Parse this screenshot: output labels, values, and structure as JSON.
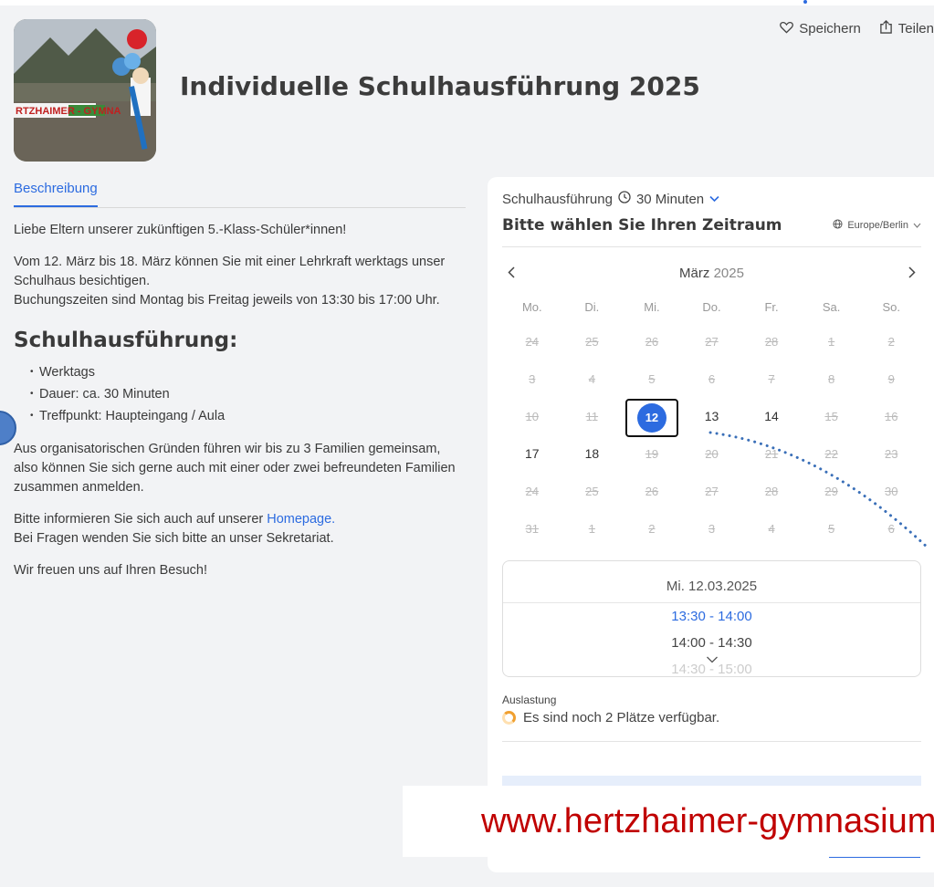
{
  "header": {
    "title": "Individuelle Schulhausführung 2025",
    "image_text": "RTZHAIMER - GYMNA",
    "save_label": "Speichern",
    "share_label": "Teilen"
  },
  "description": {
    "tab_label": "Beschreibung",
    "greeting": "Liebe Eltern unserer zukünftigen 5.-Klass-Schüler*innen!",
    "para1_line1": "Vom 12. März bis 18. März können Sie mit einer Lehrkraft werktags unser Schulhaus besichtigen.",
    "para1_line2": "Buchungszeiten sind Montag bis Freitag jeweils von 13:30 bis 17:00 Uhr.",
    "section_heading": "Schulhausführung:",
    "bullets": [
      "Werktags",
      "Dauer: ca. 30 Minuten",
      "Treffpunkt: Haupteingang / Aula"
    ],
    "para2": "Aus organisatorischen Gründen führen wir bis zu 3 Familien gemeinsam, also können Sie sich gerne auch mit einer oder zwei befreundeten Familien zusammen anmelden.",
    "para3_prefix": "Bitte informieren Sie sich auch auf unserer ",
    "para3_link": "Homepage.",
    "para3_line2": "Bei Fragen wenden Sie sich bitte an unser Sekretariat.",
    "closing": "Wir freuen uns auf Ihren Besuch!"
  },
  "booking": {
    "service_name": "Schulhausführung",
    "duration": "30 Minuten",
    "choose_title": "Bitte wählen Sie Ihren Zeitraum",
    "timezone": "Europe/Berlin",
    "month": "März",
    "year": "2025",
    "weekdays": [
      "Mo.",
      "Di.",
      "Mi.",
      "Do.",
      "Fr.",
      "Sa.",
      "So."
    ],
    "weeks": [
      [
        {
          "d": "24",
          "s": "off"
        },
        {
          "d": "25",
          "s": "off"
        },
        {
          "d": "26",
          "s": "off"
        },
        {
          "d": "27",
          "s": "off"
        },
        {
          "d": "28",
          "s": "off"
        },
        {
          "d": "1",
          "s": "off"
        },
        {
          "d": "2",
          "s": "off"
        }
      ],
      [
        {
          "d": "3",
          "s": "off"
        },
        {
          "d": "4",
          "s": "off"
        },
        {
          "d": "5",
          "s": "off"
        },
        {
          "d": "6",
          "s": "off"
        },
        {
          "d": "7",
          "s": "off"
        },
        {
          "d": "8",
          "s": "off"
        },
        {
          "d": "9",
          "s": "off"
        }
      ],
      [
        {
          "d": "10",
          "s": "off"
        },
        {
          "d": "11",
          "s": "off"
        },
        {
          "d": "12",
          "s": "sel"
        },
        {
          "d": "13",
          "s": "on"
        },
        {
          "d": "14",
          "s": "on"
        },
        {
          "d": "15",
          "s": "off"
        },
        {
          "d": "16",
          "s": "off"
        }
      ],
      [
        {
          "d": "17",
          "s": "on"
        },
        {
          "d": "18",
          "s": "on"
        },
        {
          "d": "19",
          "s": "off"
        },
        {
          "d": "20",
          "s": "off"
        },
        {
          "d": "21",
          "s": "off"
        },
        {
          "d": "22",
          "s": "off"
        },
        {
          "d": "23",
          "s": "off"
        }
      ],
      [
        {
          "d": "24",
          "s": "off"
        },
        {
          "d": "25",
          "s": "off"
        },
        {
          "d": "26",
          "s": "off"
        },
        {
          "d": "27",
          "s": "off"
        },
        {
          "d": "28",
          "s": "off"
        },
        {
          "d": "29",
          "s": "off"
        },
        {
          "d": "30",
          "s": "off"
        }
      ],
      [
        {
          "d": "31",
          "s": "off"
        },
        {
          "d": "1",
          "s": "off"
        },
        {
          "d": "2",
          "s": "off"
        },
        {
          "d": "3",
          "s": "off"
        },
        {
          "d": "4",
          "s": "off"
        },
        {
          "d": "5",
          "s": "off"
        },
        {
          "d": "6",
          "s": "off"
        }
      ]
    ],
    "selected_date": "Mi. 12.03.2025",
    "slots": [
      {
        "time": "13:30 - 14:00",
        "state": "active"
      },
      {
        "time": "14:00 - 14:30",
        "state": "normal"
      },
      {
        "time": "14:30 - 15:00",
        "state": "faded"
      }
    ],
    "utilization_label": "Auslastung",
    "utilization_text": "Es sind noch 2 Plätze verfügbar."
  },
  "watermark": "www.hertzhaimer-gymnasium.de",
  "colors": {
    "accent": "#2c6be0",
    "watermark": "#c00000",
    "utilization": "#f0a030"
  }
}
